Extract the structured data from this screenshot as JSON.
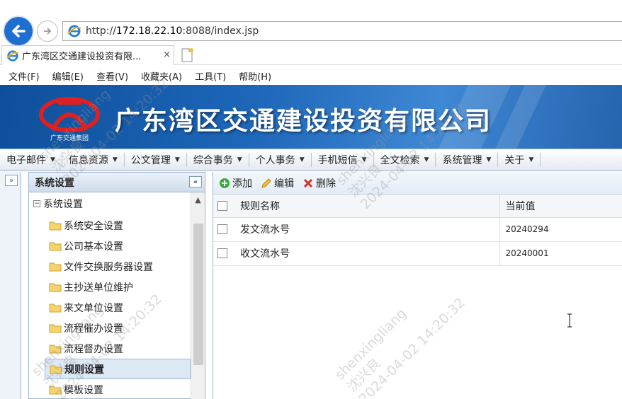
{
  "browser": {
    "url_prefix": "http://",
    "url_host": "172.18.22.10",
    "url_rest": ":8088/index.jsp",
    "tab_title": "广东湾区交通建设投资有限...",
    "tab_close": "×",
    "menu": [
      "文件(F)",
      "编辑(E)",
      "查看(V)",
      "收藏夹(A)",
      "工具(T)",
      "帮助(H)"
    ]
  },
  "banner": {
    "company": "广东湾区交通建设投资有限公司",
    "logo_text": "广东交通集团"
  },
  "nav": [
    "电子邮件",
    "信息资源",
    "公文管理",
    "综合事务",
    "个人事务",
    "手机短信",
    "全文检索",
    "系统管理",
    "关于"
  ],
  "sidebar": {
    "title": "系统设置",
    "expand_icon": "»",
    "collapse_icon": "«",
    "root": "系统设置",
    "items": [
      "系统安全设置",
      "公司基本设置",
      "文件交换服务器设置",
      "主抄送单位维护",
      "来文单位设置",
      "流程催办设置",
      "流程督办设置",
      "规则设置",
      "模板设置"
    ],
    "selected": "规则设置"
  },
  "toolbar": {
    "add": "添加",
    "edit": "编辑",
    "delete": "删除"
  },
  "table": {
    "headers": {
      "name": "规则名称",
      "value": "当前值"
    },
    "rows": [
      {
        "name": "发文流水号",
        "value": "20240294"
      },
      {
        "name": "收文流水号",
        "value": "20240001"
      }
    ]
  },
  "watermark": {
    "user": "shenxingliang",
    "name": "沈兴良",
    "time": "2024-04-02 14:20:32"
  },
  "colors": {
    "banner": "#1d66b8",
    "accent": "#9fb4cc",
    "selected_bg": "#dde8f5"
  }
}
